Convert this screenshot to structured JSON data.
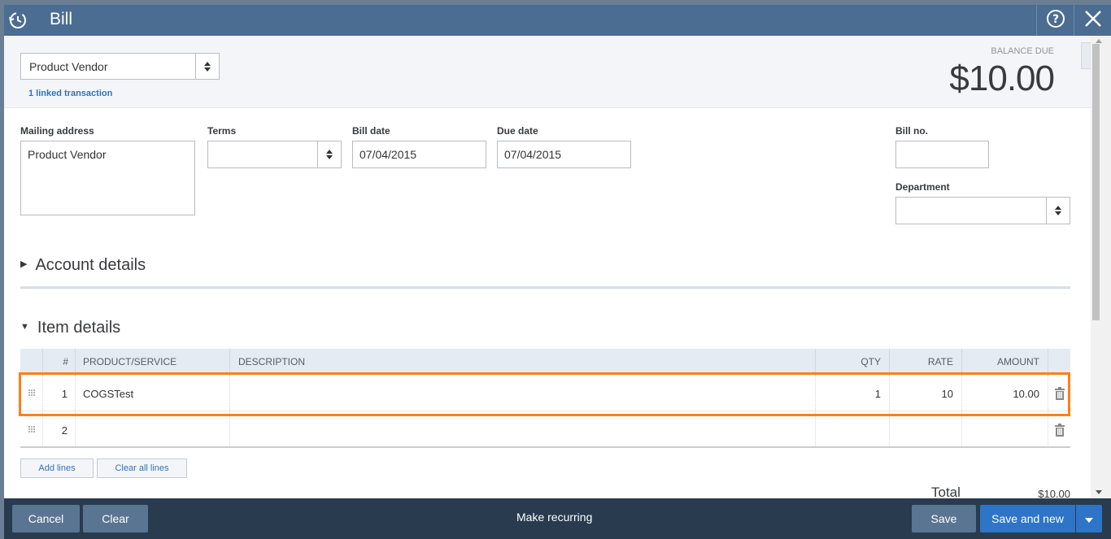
{
  "window": {
    "title": "Bill"
  },
  "vendor": {
    "selected": "Product Vendor",
    "linked": "1 linked transaction"
  },
  "balance": {
    "label": "BALANCE DUE",
    "amount": "$10.00"
  },
  "form": {
    "mailing_label": "Mailing address",
    "mailing_value": "Product Vendor",
    "terms_label": "Terms",
    "terms_value": "",
    "bill_date_label": "Bill date",
    "bill_date_value": "07/04/2015",
    "due_date_label": "Due date",
    "due_date_value": "07/04/2015",
    "bill_no_label": "Bill no.",
    "bill_no_value": "",
    "department_label": "Department",
    "department_value": ""
  },
  "sections": {
    "account": "Account details",
    "item": "Item details"
  },
  "table": {
    "headers": [
      "#",
      "PRODUCT/SERVICE",
      "DESCRIPTION",
      "QTY",
      "RATE",
      "AMOUNT"
    ],
    "rows": [
      {
        "num": "1",
        "product": "COGSTest",
        "description": "",
        "qty": "1",
        "rate": "10",
        "amount": "10.00"
      },
      {
        "num": "2",
        "product": "",
        "description": "",
        "qty": "",
        "rate": "",
        "amount": ""
      }
    ]
  },
  "actions": {
    "add_lines": "Add lines",
    "clear_all": "Clear all lines"
  },
  "totals": {
    "label": "Total",
    "value": "$10.00"
  },
  "footer": {
    "cancel": "Cancel",
    "clear": "Clear",
    "make_recurring": "Make recurring",
    "save": "Save",
    "save_and_new": "Save and new"
  },
  "colors": {
    "titlebar": "#4b6d91",
    "footer": "#283b4f",
    "highlight": "#ff7f18",
    "primary": "#2e75c7"
  }
}
